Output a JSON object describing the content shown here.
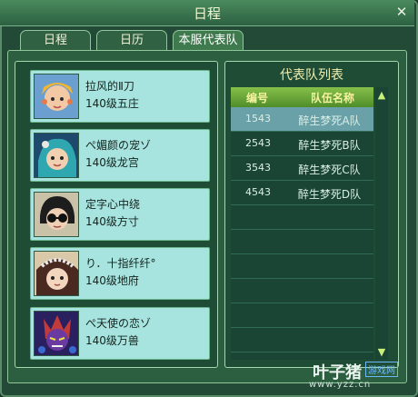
{
  "window": {
    "title": "日程"
  },
  "tabs": [
    {
      "label": "日程"
    },
    {
      "label": "日历"
    },
    {
      "label": "本服代表队"
    }
  ],
  "members": [
    {
      "name": "拉风的Ⅱ刀",
      "level": "140级五庄"
    },
    {
      "name": "ぺ媚颜の宠ゾ",
      "level": "140级龙宫"
    },
    {
      "name": "定字心中绕",
      "level": "140级方寸"
    },
    {
      "name": "り．十指纤纤°",
      "level": "140级地府"
    },
    {
      "name": "ぺ天使の恋ゾ",
      "level": "140级万兽"
    }
  ],
  "team_list": {
    "title": "代表队列表",
    "headers": {
      "id": "编号",
      "name": "队伍名称"
    },
    "rows": [
      {
        "id": "1543",
        "name": "醉生梦死A队"
      },
      {
        "id": "2543",
        "name": "醉生梦死B队"
      },
      {
        "id": "3543",
        "name": "醉生梦死C队"
      },
      {
        "id": "4543",
        "name": "醉生梦死D队"
      }
    ]
  },
  "watermark": {
    "brand": "叶子猪",
    "tag": "游戏网",
    "url": "www.yzz.cn"
  },
  "colors": {
    "accent": "#86c04a",
    "card_bg": "#a7e3df",
    "selected_row": "#6aa0a8"
  }
}
